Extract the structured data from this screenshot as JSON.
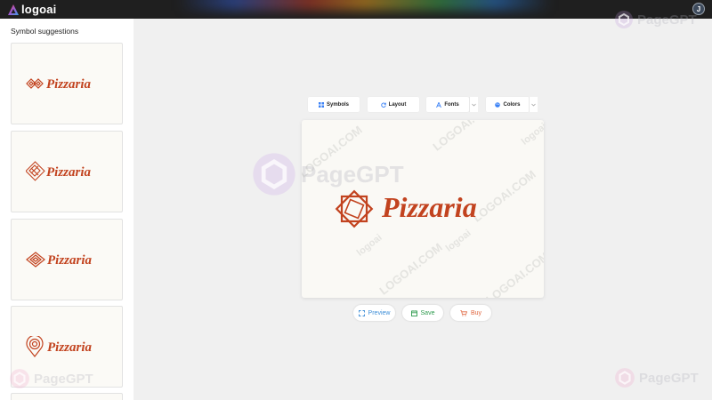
{
  "header": {
    "brand_name": "logoai",
    "avatar_initial": "J"
  },
  "sidebar": {
    "title": "Symbol suggestions",
    "suggestions": [
      {
        "text": "Pizzaria",
        "symbol": "diamond-knot-icon"
      },
      {
        "text": "Pizzaria",
        "symbol": "diamond-lattice-icon"
      },
      {
        "text": "Pizzaria",
        "symbol": "nested-diamond-icon"
      },
      {
        "text": "Pizzaria",
        "symbol": "map-pin-rings-icon"
      }
    ]
  },
  "toolbar": {
    "symbols_label": "Symbols",
    "layout_label": "Layout",
    "fonts_label": "Fonts",
    "colors_label": "Colors"
  },
  "preview": {
    "logo_text": "Pizzaria",
    "symbol": "star-octagram-icon",
    "watermark_text": "LOGOAI.COM",
    "watermark_brand": "logoai"
  },
  "actions": {
    "preview_label": "Preview",
    "save_label": "Save",
    "buy_label": "Buy"
  },
  "overlay": {
    "watermark_text": "PageGPT"
  },
  "colors": {
    "logo": "#c2431f",
    "topbar": "#1f1f1f",
    "preview_action": "#3f8fd8",
    "save_action": "#2e9b4e",
    "buy_action": "#e0663f"
  }
}
